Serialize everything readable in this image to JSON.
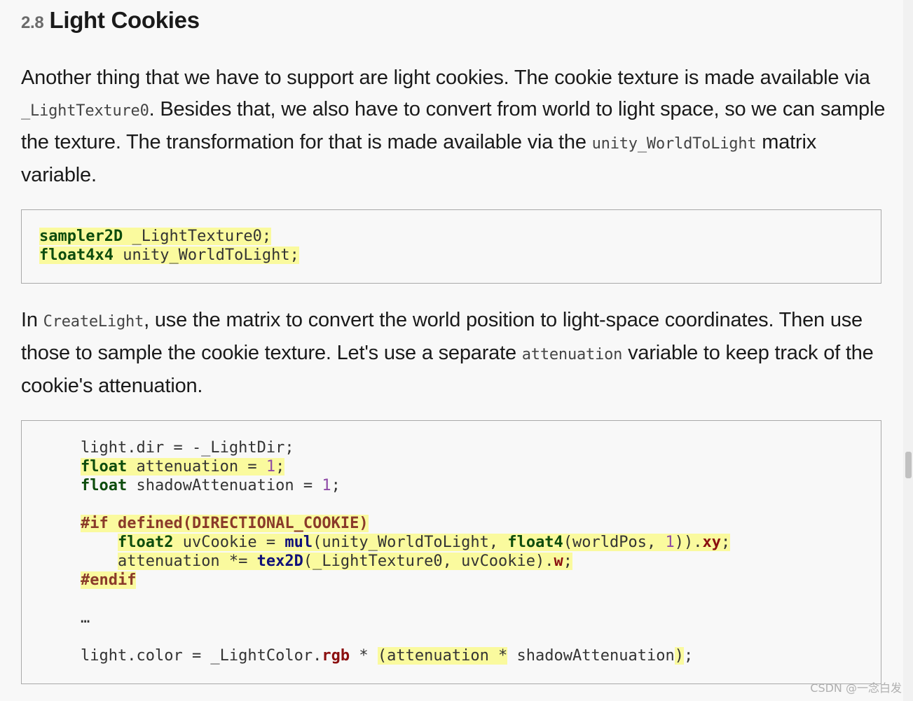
{
  "section": {
    "number": "2.8",
    "title": "Light Cookies"
  },
  "para1": {
    "t1": "Another thing that we have to support are light cookies. The cookie texture is made available via ",
    "c1": "_LightTexture0",
    "t2": ". Besides that, we also have to convert from world to light space, so we can sample the texture. The transformation for that is made available via the ",
    "c2": "unity_WorldToLight",
    "t3": " matrix variable."
  },
  "code1": {
    "l1_kw": "sampler2D",
    "l1_rest": " _LightTexture0;",
    "l2_kw": "float4x4",
    "l2_rest": " unity_WorldToLight;"
  },
  "para2": {
    "t1": "In ",
    "c1": "CreateLight",
    "t2": ", use the matrix to convert the world position to light-space coordinates. Then use those to sample the cookie texture. Let's use a separate ",
    "c2": "attenuation",
    "t3": " variable to keep track of the cookie's attenuation."
  },
  "code2": {
    "l1": "light.dir = -_LightDir;",
    "l2_kw": "float",
    "l2_mid": " attenuation = ",
    "l2_num": "1",
    "l2_end": ";",
    "l3_kw": "float",
    "l3_mid": " shadowAttenuation = ",
    "l3_num": "1",
    "l3_end": ";",
    "l5_pp": "#if defined(DIRECTIONAL_COOKIE)",
    "l6_kw": "float2",
    "l6_a": " uvCookie = ",
    "l6_fn": "mul",
    "l6_b": "(unity_WorldToLight, ",
    "l6_kw2": "float4",
    "l6_c": "(worldPos, ",
    "l6_num": "1",
    "l6_d": ")).",
    "l6_sw": "xy",
    "l6_e": ";",
    "l7_a": "attenuation *= ",
    "l7_fn": "tex2D",
    "l7_b": "(_LightTexture0, uvCookie).",
    "l7_sw": "w",
    "l7_e": ";",
    "l8_pp": "#endif",
    "l10": "…",
    "l12_a": "light.color = _LightColor.",
    "l12_sw": "rgb",
    "l12_b": " * ",
    "l12_hl": "(attenuation *",
    "l12_c": " shadowAttenuation",
    "l12_hl2": ")",
    "l12_e": ";"
  },
  "watermark": "CSDN @一念白发"
}
